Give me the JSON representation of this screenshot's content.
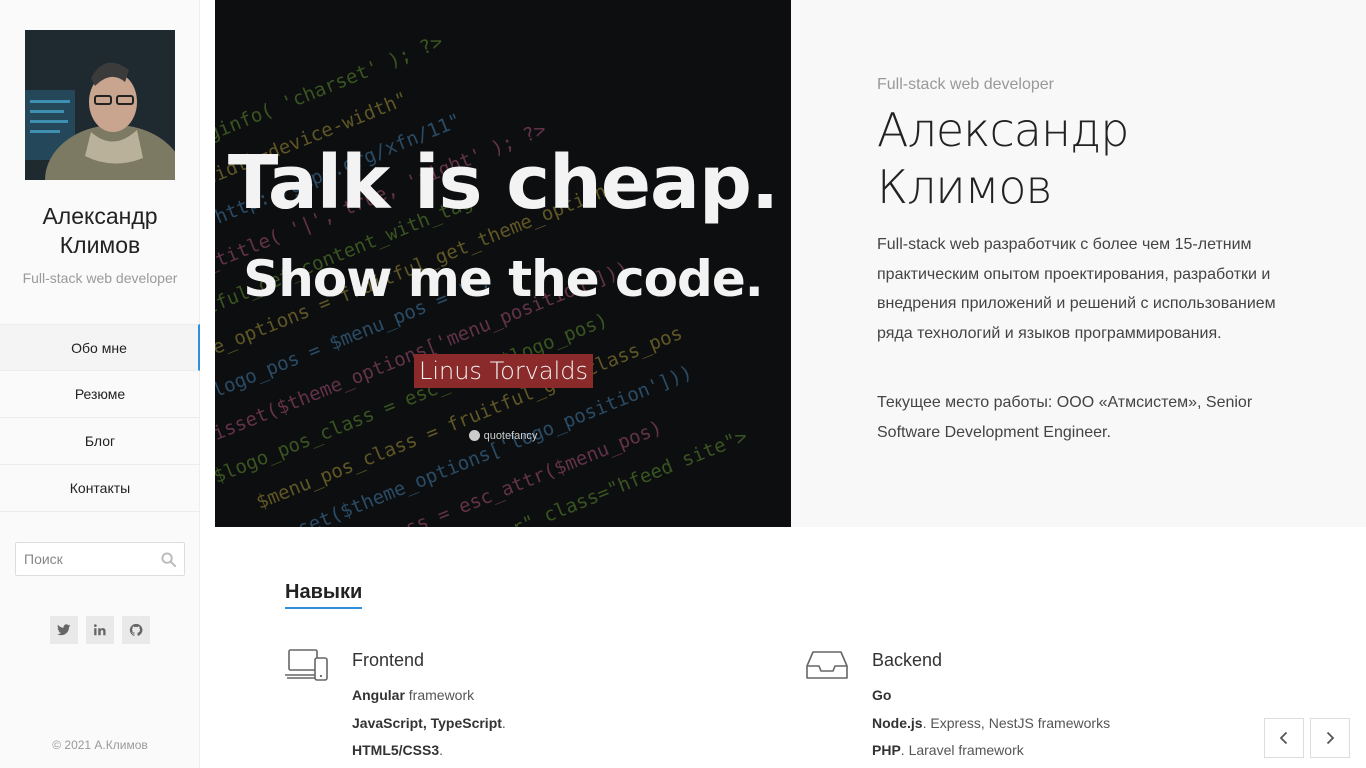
{
  "sidebar": {
    "name": "Александр Климов",
    "role": "Full-stack web developer",
    "nav": [
      {
        "label": "Обо мне",
        "active": true
      },
      {
        "label": "Резюме",
        "active": false
      },
      {
        "label": "Блог",
        "active": false
      },
      {
        "label": "Контакты",
        "active": false
      }
    ],
    "search": {
      "placeholder": "Поиск",
      "icon": "search-icon"
    },
    "socials": [
      {
        "icon": "twitter-icon"
      },
      {
        "icon": "linkedin-icon"
      },
      {
        "icon": "github-icon"
      }
    ],
    "copyright": "© 2021 А.Климов"
  },
  "hero": {
    "quote_line1": "Talk is cheap.",
    "quote_line2": "Show me the code.",
    "quote_author": "Linus Torvalds",
    "quote_brand": "quotefancy",
    "role": "Full-stack web developer",
    "name_line1": "Александр",
    "name_line2": "Климов",
    "description": "Full-stack web разработчик с более чем 15-летним практическим опытом проектирования, разработки и внедрения приложений и решений с использованием ряда технологий и языков программирования.",
    "job": "Текущее место работы: ООО «Атмсистем», Senior Software Development Engineer."
  },
  "skills": {
    "title": "Навыки",
    "frontend": {
      "title": "Frontend",
      "icon": "devices-icon",
      "items": [
        {
          "bold": "Angular",
          "rest": " framework"
        },
        {
          "bold": "JavaScript, TypeScript",
          "rest": "."
        },
        {
          "bold": "HTML5/CSS3",
          "rest": "."
        }
      ]
    },
    "backend": {
      "title": "Backend",
      "icon": "inbox-icon",
      "items": [
        {
          "bold": "Go",
          "rest": ""
        },
        {
          "bold": "Node.js",
          "rest": ". Express, NestJS frameworks"
        },
        {
          "bold": "PHP",
          "rest": ". Laravel framework"
        }
      ]
    }
  },
  "slider": {
    "prev_icon": "chevron-left-icon",
    "next_icon": "chevron-right-icon"
  },
  "colors": {
    "accent": "#2f8fd8",
    "quote_badge": "#8b2a2a"
  }
}
